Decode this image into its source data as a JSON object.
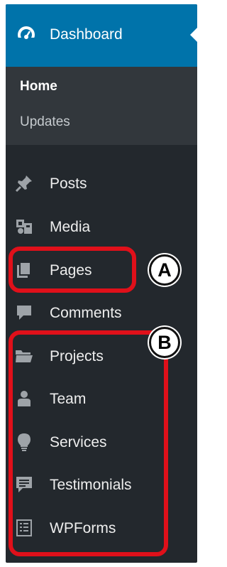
{
  "dashboard": {
    "label": "Dashboard",
    "icon": "dashboard-gauge-icon"
  },
  "submenu": {
    "home": "Home",
    "updates": "Updates"
  },
  "menu": [
    {
      "label": "Posts",
      "icon": "pushpin-icon"
    },
    {
      "label": "Media",
      "icon": "media-icon"
    },
    {
      "label": "Pages",
      "icon": "pages-icon"
    },
    {
      "label": "Comments",
      "icon": "comment-icon"
    },
    {
      "label": "Projects",
      "icon": "folder-icon"
    },
    {
      "label": "Team",
      "icon": "person-icon"
    },
    {
      "label": "Services",
      "icon": "lightbulb-icon"
    },
    {
      "label": "Testimonials",
      "icon": "testimonial-icon"
    },
    {
      "label": "WPForms",
      "icon": "form-icon"
    }
  ],
  "callouts": {
    "a": "A",
    "b": "B"
  },
  "colors": {
    "sidebar": "#23282d",
    "active": "#0073aa",
    "submenu": "#32373c",
    "callout": "#e0101a"
  }
}
